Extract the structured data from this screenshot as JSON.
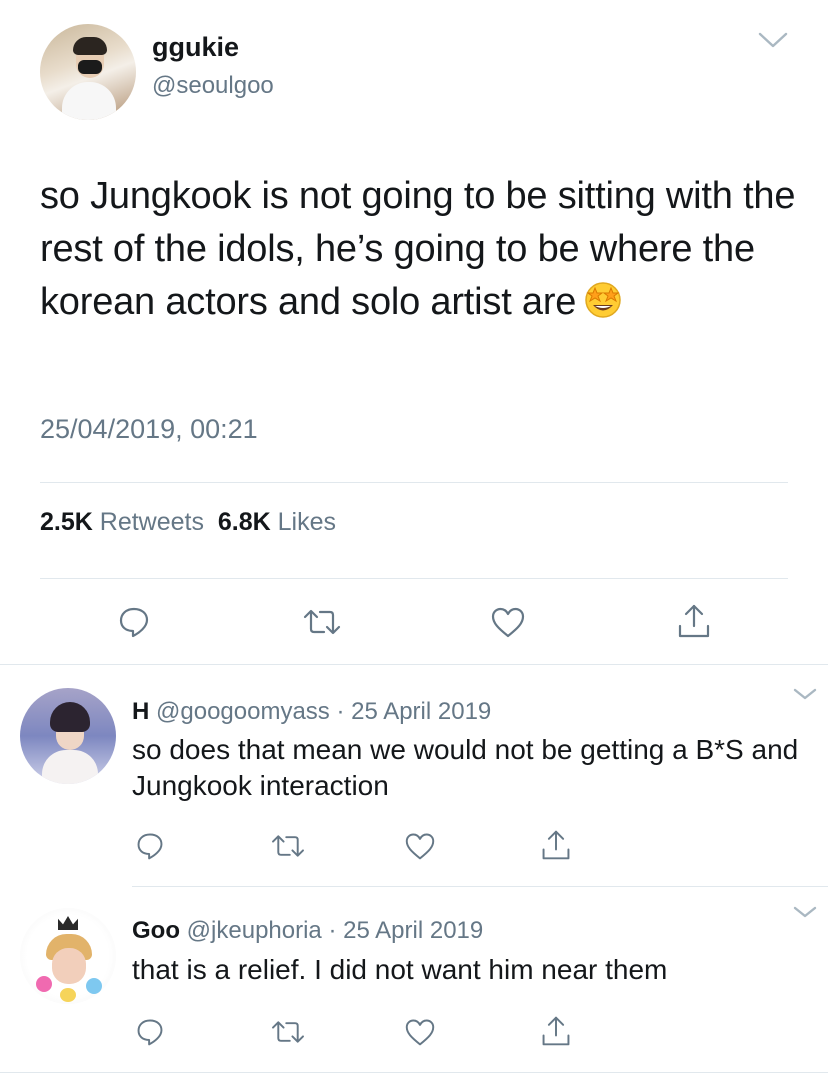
{
  "main_tweet": {
    "name": "ggukie",
    "handle": "@seoulgoo",
    "text": "so Jungkook is not going to be sitting with the rest of the idols, he’s going to be where the korean actors and solo artist are",
    "emoji": "star-struck-emoji",
    "timestamp": "25/04/2019, 00:21",
    "retweets_count": "2.5K",
    "retweets_label": "Retweets",
    "likes_count": "6.8K",
    "likes_label": "Likes"
  },
  "replies": [
    {
      "name": "H",
      "handle": "@googoomyass",
      "separator": "·",
      "date": "25 April 2019",
      "text": "so does that mean we would not be getting a B*S and Jungkook interaction"
    },
    {
      "name": "Goo",
      "handle": "@jkeuphoria",
      "separator": "·",
      "date": "25 April 2019",
      "text": "that is a relief. I did not want him near them"
    }
  ],
  "icons": {
    "reply": "reply-icon",
    "retweet": "retweet-icon",
    "like": "heart-icon",
    "share": "share-icon",
    "more": "chevron-down-icon"
  },
  "colors": {
    "text_primary": "#14171a",
    "text_secondary": "#657786",
    "divider": "#e1e8ed",
    "icon": "#657786",
    "caret": "#aab8c2"
  }
}
